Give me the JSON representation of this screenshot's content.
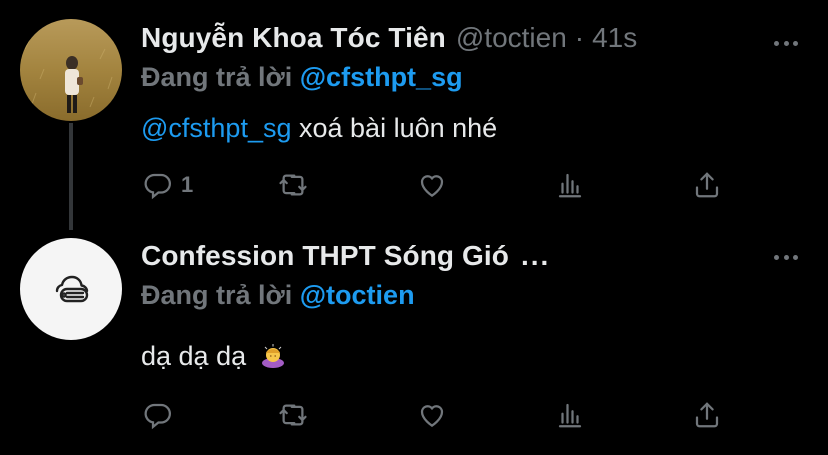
{
  "tweets": [
    {
      "name": "Nguyễn Khoa Tóc Tiên",
      "handle": "@toctien",
      "dot": "·",
      "time": "41s",
      "replying_prefix": "Đang trả lời",
      "replying_to": "@cfsthpt_sg",
      "body_mention": "@cfsthpt_sg",
      "body_text": "xoá bài luôn nhé",
      "reply_count": "1"
    },
    {
      "name": "Confession THPT Sóng Gió",
      "name_ellipsis": "...",
      "replying_prefix": "Đang trả lời",
      "replying_to": "@toctien",
      "body_text": "dạ dạ dạ"
    }
  ],
  "icons": {
    "reply": "reply-icon",
    "retweet": "retweet-icon",
    "like": "heart-icon",
    "analytics": "analytics-icon",
    "share": "share-icon",
    "more": "more-icon"
  },
  "colors": {
    "background": "#000000",
    "text": "#e7e9ea",
    "muted": "#71767b",
    "accent": "#1d9bf0"
  }
}
